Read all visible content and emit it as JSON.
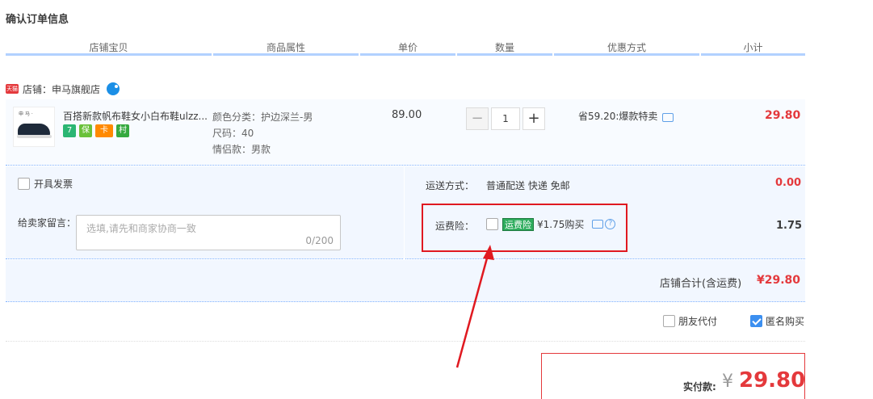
{
  "page": {
    "title": "确认订单信息"
  },
  "columns": [
    "店铺宝贝",
    "商品属性",
    "单价",
    "数量",
    "优惠方式",
    "小计"
  ],
  "shop": {
    "badge": "天猫",
    "label": "店铺：申马旗舰店"
  },
  "item": {
    "thumb_tag": "申 马 ·",
    "title": "百搭新款帆布鞋女小白布鞋ulzz...",
    "badges": [
      "7",
      "保",
      "卡",
      "村"
    ],
    "attrs": [
      "颜色分类：护边深兰-男",
      "尺码：40",
      "情侣款：男款"
    ],
    "unit_price": "89.00",
    "qty_minus": "−",
    "qty": "1",
    "qty_plus": "+",
    "discount": "省59.20:爆款特卖",
    "subtotal": "29.80"
  },
  "invoice": {
    "label": "开具发票"
  },
  "memo": {
    "label": "给卖家留言：",
    "placeholder": "选填,请先和商家协商一致",
    "count": "0/200"
  },
  "shipping": {
    "label": "运送方式：",
    "value": "普通配送 快递 免邮",
    "fee": "0.00"
  },
  "insurance": {
    "label": "运费险：",
    "tag": "运费险",
    "price": "¥1.75购买",
    "help": "?",
    "fee": "1.75"
  },
  "shop_total": {
    "label": "店铺合计(含运费)",
    "value": "¥29.80"
  },
  "options": {
    "friend_pay": "朋友代付",
    "anonymous": "匿名购买"
  },
  "payment": {
    "label": "实付款:",
    "currency": "¥",
    "amount": "29.80"
  },
  "colors": {
    "accent_red": "#e4393c",
    "header_line": "#b2d1ff",
    "annotation_red": "#e01920",
    "check_blue": "#3c8ff0"
  }
}
